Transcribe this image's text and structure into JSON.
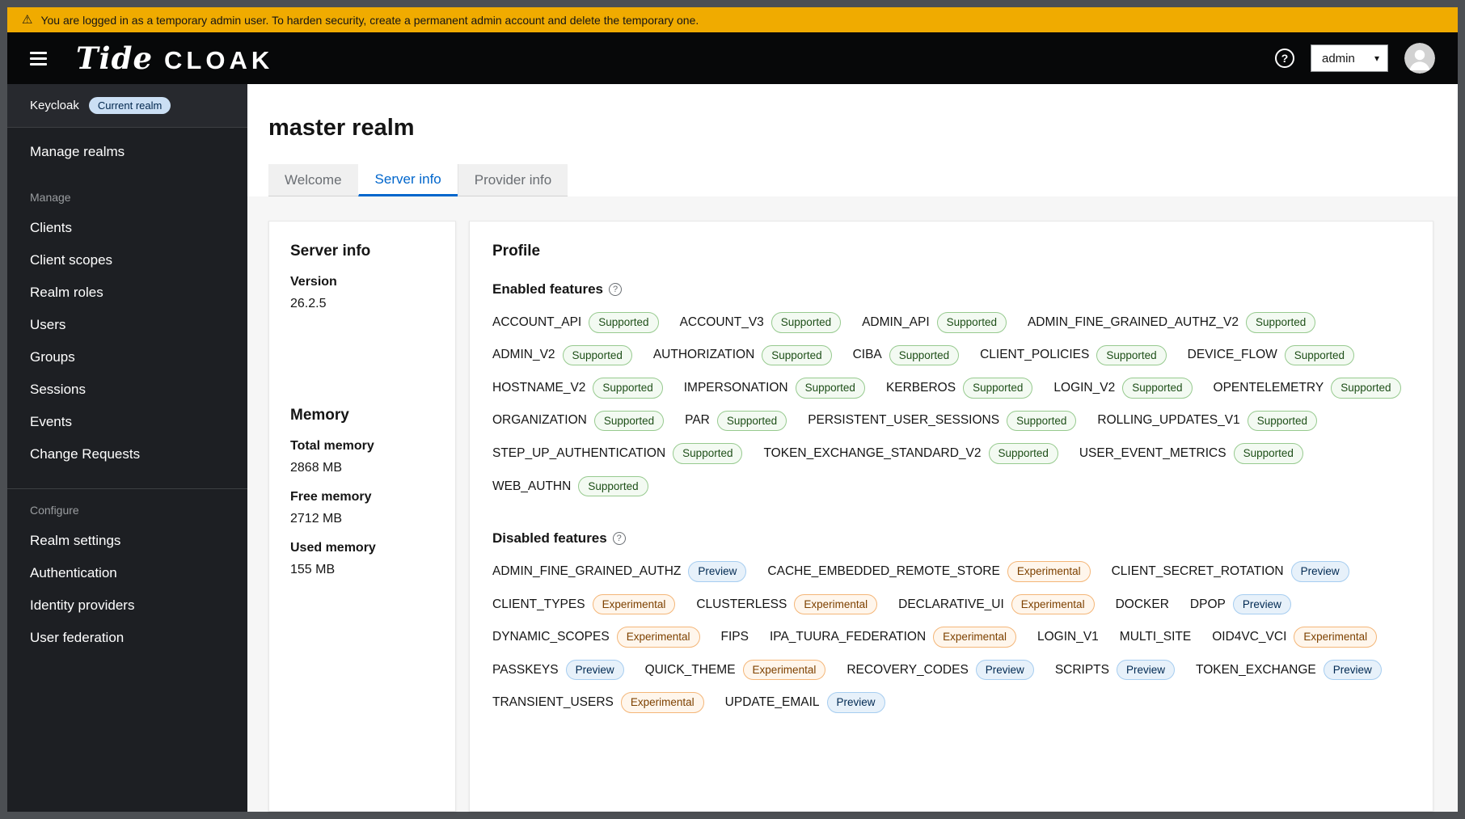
{
  "colors": {
    "banner_bg": "#f0ab00",
    "accent_blue": "#0066cc",
    "supported_badge": "#1e4f18",
    "preview_badge": "#002952",
    "experimental_badge": "#7d4100"
  },
  "icons": {
    "warning": "⚠",
    "help": "?",
    "chevron_down": "▾"
  },
  "banner": {
    "text": "You are logged in as a temporary admin user. To harden security, create a permanent admin account and delete the temporary one."
  },
  "masthead": {
    "brand_primary": "Tide",
    "brand_secondary": "CLOAK",
    "user_menu_label": "admin"
  },
  "sidebar": {
    "brand_label": "Keycloak",
    "current_realm_badge": "Current realm",
    "manage_realms_label": "Manage realms",
    "manage_section_label": "Manage",
    "manage_items": [
      "Clients",
      "Client scopes",
      "Realm roles",
      "Users",
      "Groups",
      "Sessions",
      "Events",
      "Change Requests"
    ],
    "configure_section_label": "Configure",
    "configure_items": [
      "Realm settings",
      "Authentication",
      "Identity providers",
      "User federation"
    ]
  },
  "page": {
    "title": "master realm",
    "tabs": [
      {
        "label": "Welcome",
        "active": false
      },
      {
        "label": "Server info",
        "active": true
      },
      {
        "label": "Provider info",
        "active": false
      }
    ]
  },
  "server_info_card": {
    "title": "Server info",
    "version_label": "Version",
    "version_value": "26.2.5",
    "memory_title": "Memory",
    "memory_fields": [
      {
        "label": "Total memory",
        "value": "2868 MB"
      },
      {
        "label": "Free memory",
        "value": "2712 MB"
      },
      {
        "label": "Used memory",
        "value": "155 MB"
      }
    ]
  },
  "profile_card": {
    "title": "Profile",
    "enabled_label": "Enabled features",
    "enabled_features": [
      {
        "name": "ACCOUNT_API",
        "badge": "Supported"
      },
      {
        "name": "ACCOUNT_V3",
        "badge": "Supported"
      },
      {
        "name": "ADMIN_API",
        "badge": "Supported"
      },
      {
        "name": "ADMIN_FINE_GRAINED_AUTHZ_V2",
        "badge": "Supported"
      },
      {
        "name": "ADMIN_V2",
        "badge": "Supported"
      },
      {
        "name": "AUTHORIZATION",
        "badge": "Supported"
      },
      {
        "name": "CIBA",
        "badge": "Supported"
      },
      {
        "name": "CLIENT_POLICIES",
        "badge": "Supported"
      },
      {
        "name": "DEVICE_FLOW",
        "badge": "Supported"
      },
      {
        "name": "HOSTNAME_V2",
        "badge": "Supported"
      },
      {
        "name": "IMPERSONATION",
        "badge": "Supported"
      },
      {
        "name": "KERBEROS",
        "badge": "Supported"
      },
      {
        "name": "LOGIN_V2",
        "badge": "Supported"
      },
      {
        "name": "OPENTELEMETRY",
        "badge": "Supported"
      },
      {
        "name": "ORGANIZATION",
        "badge": "Supported"
      },
      {
        "name": "PAR",
        "badge": "Supported"
      },
      {
        "name": "PERSISTENT_USER_SESSIONS",
        "badge": "Supported"
      },
      {
        "name": "ROLLING_UPDATES_V1",
        "badge": "Supported"
      },
      {
        "name": "STEP_UP_AUTHENTICATION",
        "badge": "Supported"
      },
      {
        "name": "TOKEN_EXCHANGE_STANDARD_V2",
        "badge": "Supported"
      },
      {
        "name": "USER_EVENT_METRICS",
        "badge": "Supported"
      },
      {
        "name": "WEB_AUTHN",
        "badge": "Supported"
      }
    ],
    "disabled_label": "Disabled features",
    "disabled_features": [
      {
        "name": "ADMIN_FINE_GRAINED_AUTHZ",
        "badge": "Preview"
      },
      {
        "name": "CACHE_EMBEDDED_REMOTE_STORE",
        "badge": "Experimental"
      },
      {
        "name": "CLIENT_SECRET_ROTATION",
        "badge": "Preview"
      },
      {
        "name": "CLIENT_TYPES",
        "badge": "Experimental"
      },
      {
        "name": "CLUSTERLESS",
        "badge": "Experimental"
      },
      {
        "name": "DECLARATIVE_UI",
        "badge": "Experimental"
      },
      {
        "name": "DOCKER",
        "badge": null
      },
      {
        "name": "DPOP",
        "badge": "Preview"
      },
      {
        "name": "DYNAMIC_SCOPES",
        "badge": "Experimental"
      },
      {
        "name": "FIPS",
        "badge": null
      },
      {
        "name": "IPA_TUURA_FEDERATION",
        "badge": "Experimental"
      },
      {
        "name": "LOGIN_V1",
        "badge": null
      },
      {
        "name": "MULTI_SITE",
        "badge": null
      },
      {
        "name": "OID4VC_VCI",
        "badge": "Experimental"
      },
      {
        "name": "PASSKEYS",
        "badge": "Preview"
      },
      {
        "name": "QUICK_THEME",
        "badge": "Experimental"
      },
      {
        "name": "RECOVERY_CODES",
        "badge": "Preview"
      },
      {
        "name": "SCRIPTS",
        "badge": "Preview"
      },
      {
        "name": "TOKEN_EXCHANGE",
        "badge": "Preview"
      },
      {
        "name": "TRANSIENT_USERS",
        "badge": "Experimental"
      },
      {
        "name": "UPDATE_EMAIL",
        "badge": "Preview"
      }
    ]
  }
}
